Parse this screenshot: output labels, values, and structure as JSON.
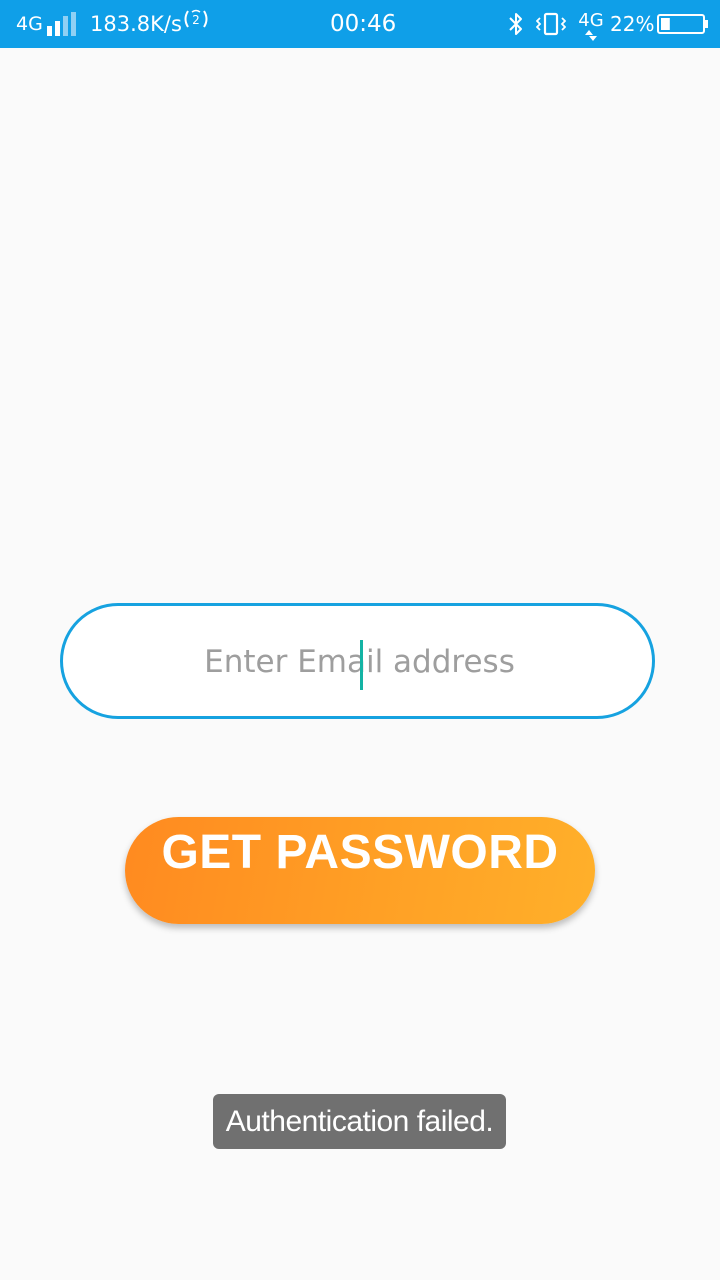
{
  "status_bar": {
    "network_type": "4G",
    "data_speed": "183.8K/s",
    "time": "00:46",
    "network_type_2": "4G",
    "battery_percent": "22%",
    "battery_level": 0.22,
    "icons": [
      "signal-icon",
      "wifi-calling-icon",
      "bluetooth-icon",
      "vibrate-icon",
      "data-arrows-icon",
      "battery-icon"
    ],
    "background_color": "#0f9fe8"
  },
  "email": {
    "placeholder": "Enter Email address",
    "value": "",
    "border_color": "#16a2e0"
  },
  "get_password_button": {
    "label": "GET PASSWORD",
    "color_start": "#ff8a20",
    "color_end": "#ffb02a"
  },
  "toast": {
    "message": "Authentication failed."
  }
}
